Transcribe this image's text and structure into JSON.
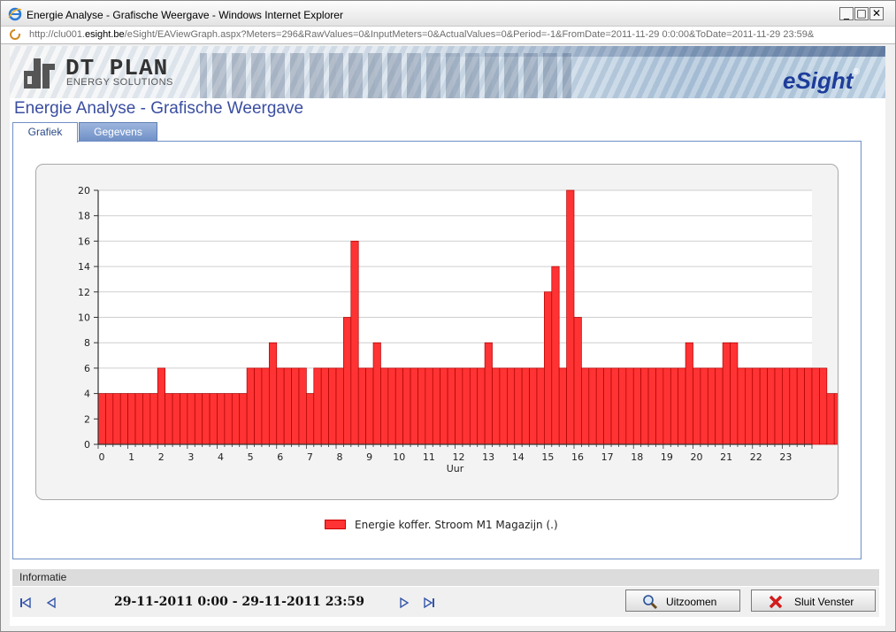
{
  "window": {
    "title": "Energie Analyse - Grafische Weergave - Windows Internet Explorer",
    "url_prefix": "http://clu001.",
    "url_domain": "esight.be",
    "url_rest": "/eSight/EAViewGraph.aspx?Meters=296&RawValues=0&InputMeters=0&ActualValues=0&Period=-1&FromDate=2011-11-29 0:0:00&ToDate=2011-11-29 23:59&",
    "buttons": {
      "minimize": "_",
      "maximize": "□",
      "close": "✕"
    }
  },
  "banner": {
    "company_name": "DT PLAN",
    "company_sub": "ENERGY SOLUTIONS",
    "product": "eSight",
    "product_mark": "®"
  },
  "page": {
    "title": "Energie Analyse - Grafische Weergave",
    "tabs": [
      {
        "label": "Grafiek",
        "active": true
      },
      {
        "label": "Gegevens",
        "active": false
      }
    ]
  },
  "chart_data": {
    "type": "bar",
    "xlabel": "Uur",
    "ylabel": "",
    "ylim": [
      0,
      20
    ],
    "yticks": [
      0,
      2,
      4,
      6,
      8,
      10,
      12,
      14,
      16,
      18,
      20
    ],
    "xticks": [
      "0",
      "1",
      "2",
      "3",
      "4",
      "5",
      "6",
      "7",
      "8",
      "9",
      "10",
      "11",
      "12",
      "13",
      "14",
      "15",
      "16",
      "17",
      "18",
      "19",
      "20",
      "21",
      "22",
      "23"
    ],
    "interval_hours": 0.25,
    "series": [
      {
        "name": "Energie koffer. Stroom M1 Magazijn (.)",
        "color": "#ff3333",
        "values": [
          4,
          4,
          4,
          4,
          4,
          4,
          4,
          4,
          6,
          4,
          4,
          4,
          4,
          4,
          4,
          4,
          4,
          4,
          4,
          4,
          6,
          6,
          6,
          8,
          6,
          6,
          6,
          6,
          4,
          6,
          6,
          6,
          6,
          10,
          16,
          6,
          6,
          8,
          6,
          6,
          6,
          6,
          6,
          6,
          6,
          6,
          6,
          6,
          6,
          6,
          6,
          6,
          8,
          6,
          6,
          6,
          6,
          6,
          6,
          6,
          12,
          14,
          6,
          20,
          10,
          6,
          6,
          6,
          6,
          6,
          6,
          6,
          6,
          6,
          6,
          6,
          6,
          6,
          6,
          8,
          6,
          6,
          6,
          6,
          8,
          8,
          6,
          6,
          6,
          6,
          6,
          6,
          6,
          6,
          6,
          6,
          6,
          6,
          4,
          4
        ]
      }
    ]
  },
  "legend": {
    "label": "Energie koffer. Stroom M1 Magazijn (.)"
  },
  "info": {
    "header": "Informatie",
    "date_range": "29-11-2011 0:00 - 29-11-2011 23:59",
    "zoom_button": "Uitzoomen",
    "close_button": "Sluit Venster"
  }
}
